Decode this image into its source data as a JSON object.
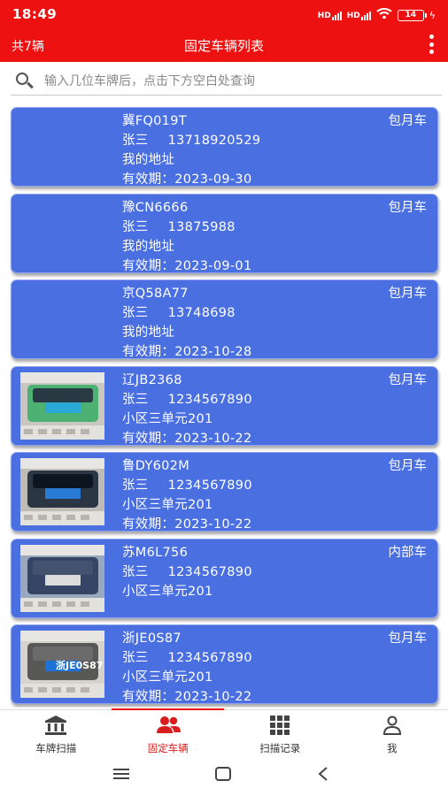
{
  "status_bar": {
    "time": "18:49",
    "signal1": "HD",
    "signal2": "HD",
    "battery": "14"
  },
  "header": {
    "count": "共7辆",
    "title": "固定车辆列表"
  },
  "search": {
    "placeholder": "输入几位车牌后，点击下方空白处查询",
    "value": ""
  },
  "vehicles": [
    {
      "plate": "冀FQ019T",
      "owner": "张三",
      "phone": "13718920529",
      "address": "我的地址",
      "validity": "有效期：2023-09-30",
      "type": "包月车",
      "has_photo": false
    },
    {
      "plate": "豫CN6666",
      "owner": "张三",
      "phone": "13875988",
      "address": "我的地址",
      "validity": "有效期：2023-09-01",
      "type": "包月车",
      "has_photo": false
    },
    {
      "plate": "京Q58A77",
      "owner": "张三",
      "phone": "13748698",
      "address": "我的地址",
      "validity": "有效期：2023-10-28",
      "type": "包月车",
      "has_photo": false
    },
    {
      "plate": "辽JB2368",
      "owner": "张三",
      "phone": "1234567890",
      "address": "小区三单元201",
      "validity": "有效期：2023-10-22",
      "type": "包月车",
      "has_photo": true
    },
    {
      "plate": "鲁DY602M",
      "owner": "张三",
      "phone": "1234567890",
      "address": "小区三单元201",
      "validity": "有效期：2023-10-22",
      "type": "包月车",
      "has_photo": true
    },
    {
      "plate": "苏M6L756",
      "owner": "张三",
      "phone": "1234567890",
      "address": "小区三单元201",
      "validity": "",
      "type": "内部车",
      "has_photo": true
    },
    {
      "plate": "浙JE0S87",
      "owner": "张三",
      "phone": "1234567890",
      "address": "小区三单元201",
      "validity": "有效期：2023-10-22",
      "type": "包月车",
      "has_photo": true,
      "photo_text": "浙JE0S87"
    }
  ],
  "bottom_nav": {
    "items": [
      {
        "label": "车牌扫描",
        "icon": "bank-icon"
      },
      {
        "label": "固定车辆",
        "icon": "users-icon",
        "active": true
      },
      {
        "label": "扫描记录",
        "icon": "grid-icon"
      },
      {
        "label": "我",
        "icon": "person-icon"
      }
    ]
  },
  "colors": {
    "accent": "#ee1111",
    "card": "#4a6fe1",
    "active_nav": "#d81e1e"
  }
}
